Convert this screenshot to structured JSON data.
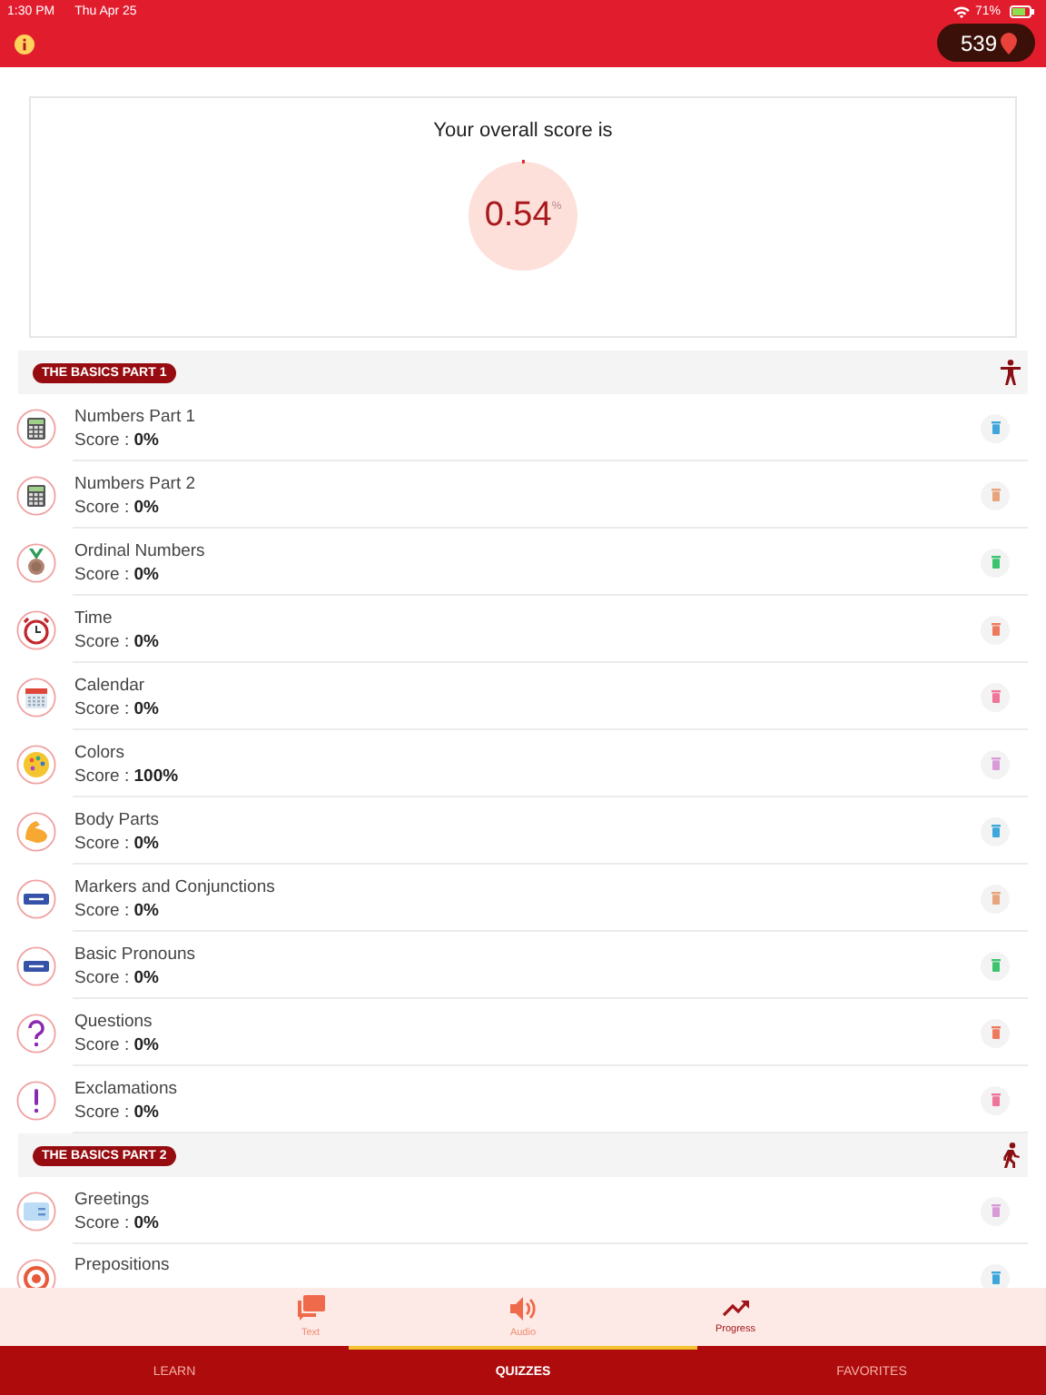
{
  "status_bar": {
    "time": "1:30 PM",
    "date": "Thu Apr 25",
    "battery": "71%"
  },
  "header": {
    "points": "539"
  },
  "overall": {
    "title": "Your overall score is",
    "value": "0.54",
    "unit": "%",
    "level": 0.0054
  },
  "sections": [
    {
      "title": "THE BASICS PART 1",
      "items": [
        {
          "name": "Numbers Part 1",
          "score": "Score : **0%**",
          "color": "#3fa6dc"
        },
        {
          "name": "Numbers Part 2",
          "score": "Score : **0%**",
          "color": "#e8a47c"
        },
        {
          "name": "Ordinal Numbers",
          "score": "Score : **0%**",
          "color": "#3cc46e"
        },
        {
          "name": "Time",
          "score": "Score : **0%**",
          "color": "#ee7a5e"
        },
        {
          "name": "Calendar",
          "score": "Score : **0%**",
          "color": "#f0739a"
        },
        {
          "name": "Colors",
          "score": "Score : **100%**",
          "color": "#d99ad8"
        },
        {
          "name": "Body Parts",
          "score": "Score : **0%**",
          "color": "#3fa6dc"
        },
        {
          "name": "Markers and Conjunctions",
          "score": "Score : **0%**",
          "color": "#e8a47c"
        },
        {
          "name": "Basic Pronouns",
          "score": "Score : **0%**",
          "color": "#3cc46e"
        },
        {
          "name": "Questions",
          "score": "Score : **0%**",
          "color": "#ee7a5e"
        },
        {
          "name": "Exclamations",
          "score": "Score : **0%**",
          "color": "#f0739a"
        }
      ]
    },
    {
      "title": "THE BASICS PART 2",
      "items": [
        {
          "name": "Greetings",
          "score": "Score : **0%**",
          "color": "#d99ad8"
        },
        {
          "name": "Prepositions",
          "color": "#3fa6dc"
        }
      ]
    }
  ],
  "sub_tabs": [
    {
      "label": "Text",
      "selected": false
    },
    {
      "label": "Audio",
      "selected": false
    },
    {
      "label": "Progress",
      "selected": true
    }
  ],
  "main_tabs": [
    {
      "label": "LEARN",
      "selected": false
    },
    {
      "label": "QUIZZES",
      "selected": true
    },
    {
      "label": "FAVORITES",
      "selected": false
    }
  ]
}
